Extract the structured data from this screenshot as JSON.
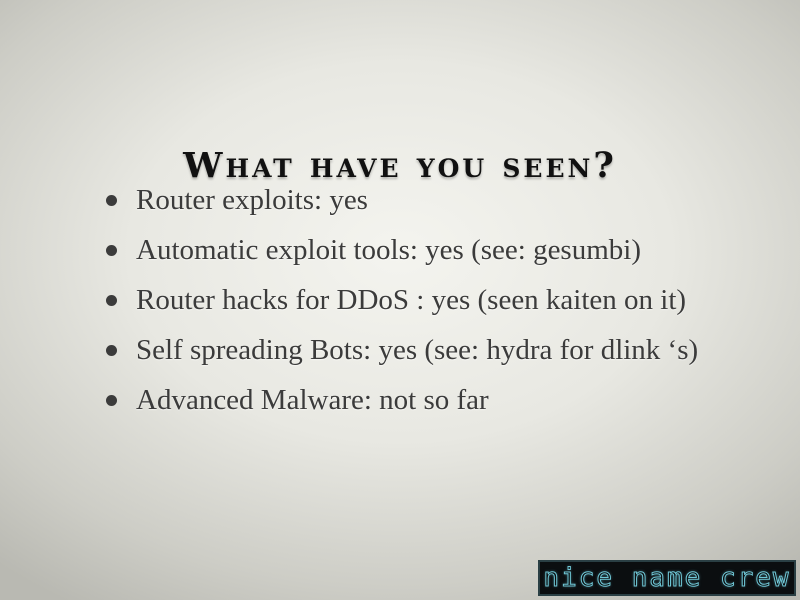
{
  "slide": {
    "title": "What have you seen?",
    "bullets": [
      "Router exploits: yes",
      "Automatic exploit tools: yes (see: gesumbi)",
      "Router hacks for DDoS : yes (seen kaiten on it)",
      "Self spreading Bots:  yes (see: hydra  for dlink ‘s)",
      "Advanced Malware:  not so far"
    ]
  },
  "logo": {
    "text": "nice name crew"
  },
  "colors": {
    "title": "#111111",
    "body_text": "#3b3b3b",
    "logo_bg": "#0b0e10",
    "logo_outline": "#6fc7d6"
  }
}
